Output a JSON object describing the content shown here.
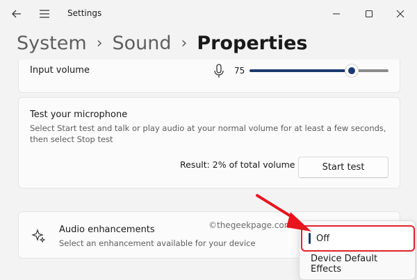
{
  "app": {
    "title": "Settings"
  },
  "breadcrumb": {
    "part1": "System",
    "part2": "Sound",
    "current": "Properties",
    "separator": "›"
  },
  "input_volume": {
    "label": "Input volume",
    "value": "75",
    "level_percent": 75
  },
  "test_mic": {
    "title": "Test your microphone",
    "description": "Select Start test and talk or play audio at your normal volume for at least a few seconds, then select Stop test",
    "result": "Result: 2% of total volume",
    "button": "Start test"
  },
  "enhancements": {
    "title": "Audio enhancements",
    "description": "Select an enhancement available for your device",
    "options": [
      "Off",
      "Device Default Effects"
    ],
    "selected": "Off"
  },
  "watermark": "©thegeekpage.com",
  "colors": {
    "accent": "#1a3a6e",
    "highlight_box": "#e0202a",
    "arrow": "#e8141e"
  }
}
